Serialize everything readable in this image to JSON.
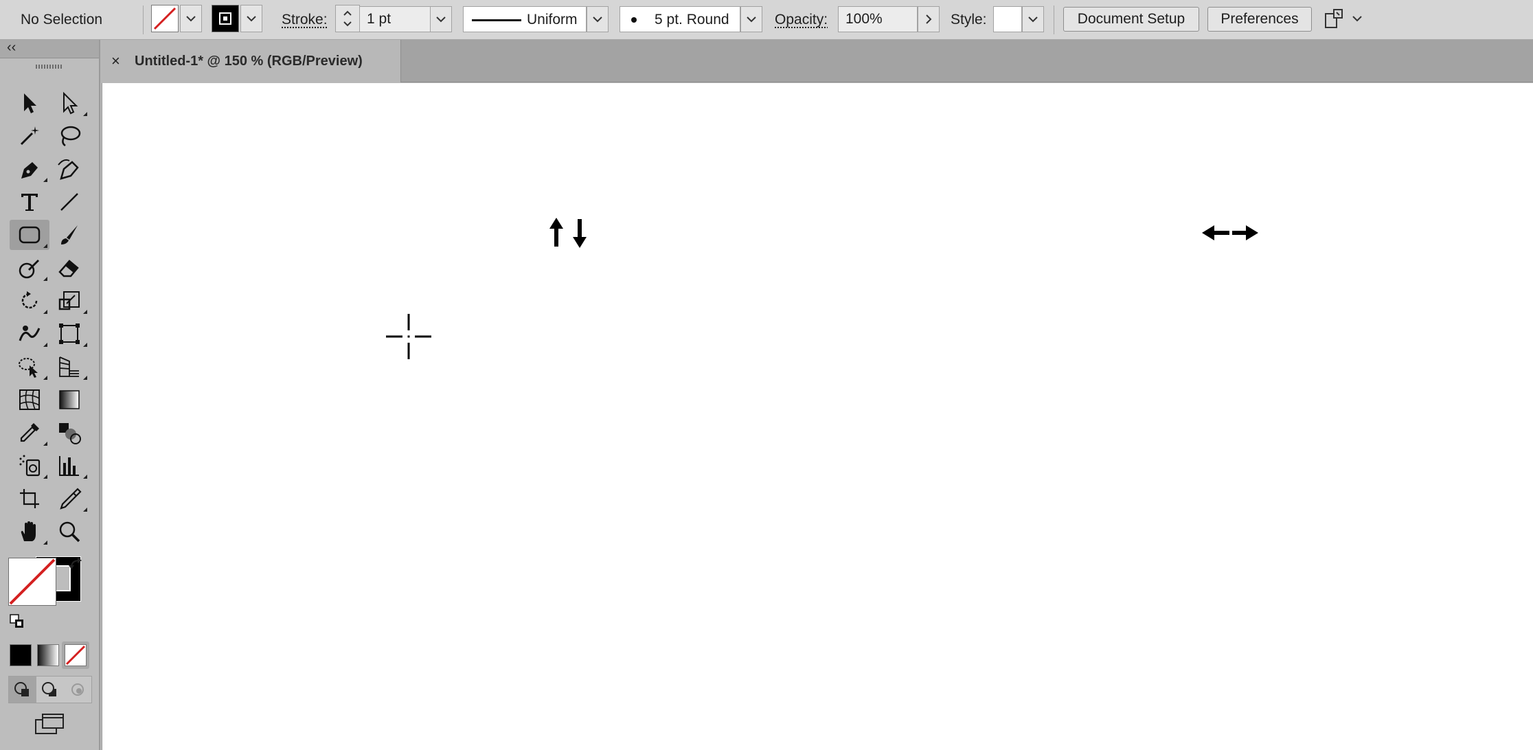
{
  "control_bar": {
    "selection_label": "No Selection",
    "stroke_label": "Stroke:",
    "stroke_weight": "1 pt",
    "profile_label": "Uniform",
    "brush_label": "5 pt. Round",
    "opacity_label": "Opacity:",
    "opacity_value": "100%",
    "style_label": "Style:",
    "document_setup_label": "Document Setup",
    "preferences_label": "Preferences"
  },
  "document": {
    "tab_title": "Untitled-1* @ 150 % (RGB/Preview)",
    "close_glyph": "×"
  },
  "toolbar": {
    "collapse_glyph": "‹‹",
    "tools": [
      "selection-tool-icon",
      "direct-selection-tool-icon",
      "magic-wand-tool-icon",
      "lasso-tool-icon",
      "pen-tool-icon",
      "curvature-tool-icon",
      "type-tool-icon",
      "line-segment-tool-icon",
      "rounded-rectangle-tool-icon",
      "paintbrush-tool-icon",
      "shaper-tool-icon",
      "eraser-tool-icon",
      "rotate-tool-icon",
      "scale-tool-icon",
      "warp-tool-icon",
      "free-transform-tool-icon",
      "shape-builder-tool-icon",
      "perspective-grid-tool-icon",
      "mesh-tool-icon",
      "gradient-tool-icon",
      "eyedropper-tool-icon",
      "blend-tool-icon",
      "symbol-sprayer-tool-icon",
      "column-graph-tool-icon",
      "artboard-tool-icon",
      "slice-tool-icon",
      "hand-tool-icon",
      "zoom-tool-icon"
    ],
    "active_tool": "rounded-rectangle-tool-icon"
  },
  "colors": {
    "fill": "none",
    "stroke": "#000000",
    "none_slash": "#d42020"
  },
  "canvas_glyphs": [
    "cursor-crosshair-icon",
    "resize-vertical-cursor-icon",
    "resize-horizontal-cursor-icon"
  ]
}
